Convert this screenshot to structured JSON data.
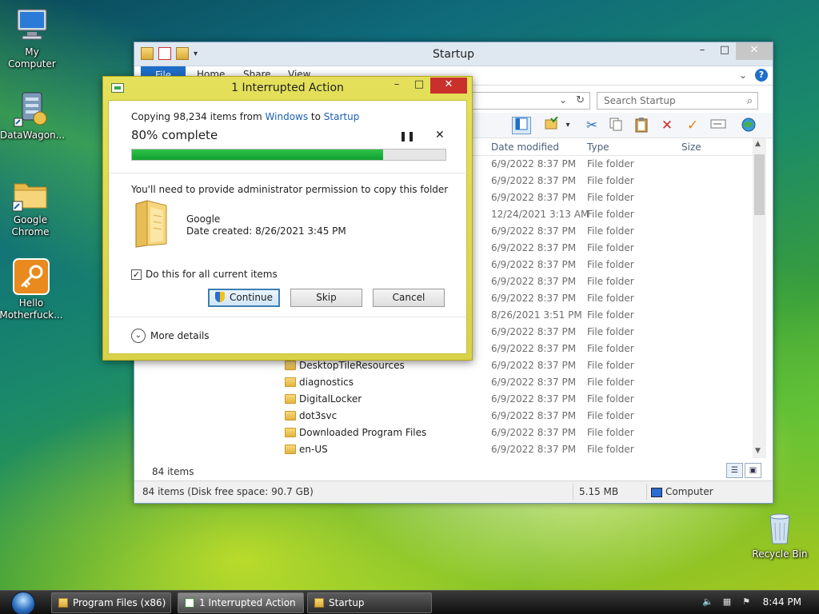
{
  "desktop": {
    "icons": [
      {
        "label": "My Computer"
      },
      {
        "label": "DataWagon..."
      },
      {
        "label": "Google Chrome"
      },
      {
        "label": "Hello Motherfuck..."
      },
      {
        "label": "Recycle Bin"
      }
    ]
  },
  "explorer": {
    "title": "Startup",
    "tabs": {
      "file": "File",
      "home": "Home",
      "share": "Share",
      "view": "View"
    },
    "search_placeholder": "Search Startup",
    "columns": {
      "date": "Date modified",
      "type": "Type",
      "size": "Size"
    },
    "rows": [
      {
        "name": "",
        "date": "6/9/2022 8:37 PM",
        "type": "File folder"
      },
      {
        "name": "",
        "date": "6/9/2022 8:37 PM",
        "type": "File folder"
      },
      {
        "name": "",
        "date": "6/9/2022 8:37 PM",
        "type": "File folder"
      },
      {
        "name": "",
        "date": "12/24/2021 3:13 AM",
        "type": "File folder"
      },
      {
        "name": "",
        "date": "6/9/2022 8:37 PM",
        "type": "File folder"
      },
      {
        "name": "",
        "date": "6/9/2022 8:37 PM",
        "type": "File folder"
      },
      {
        "name": "",
        "date": "6/9/2022 8:37 PM",
        "type": "File folder"
      },
      {
        "name": "",
        "date": "6/9/2022 8:37 PM",
        "type": "File folder"
      },
      {
        "name": "",
        "date": "6/9/2022 8:37 PM",
        "type": "File folder"
      },
      {
        "name": "",
        "date": "8/26/2021 3:51 PM",
        "type": "File folder"
      },
      {
        "name": "",
        "date": "6/9/2022 8:37 PM",
        "type": "File folder"
      },
      {
        "name": "",
        "date": "6/9/2022 8:37 PM",
        "type": "File folder"
      },
      {
        "name": "DesktopTileResources",
        "date": "6/9/2022 8:37 PM",
        "type": "File folder"
      },
      {
        "name": "diagnostics",
        "date": "6/9/2022 8:37 PM",
        "type": "File folder"
      },
      {
        "name": "DigitalLocker",
        "date": "6/9/2022 8:37 PM",
        "type": "File folder"
      },
      {
        "name": "dot3svc",
        "date": "6/9/2022 8:37 PM",
        "type": "File folder"
      },
      {
        "name": "Downloaded Program Files",
        "date": "6/9/2022 8:37 PM",
        "type": "File folder"
      },
      {
        "name": "en-US",
        "date": "6/9/2022 8:37 PM",
        "type": "File folder"
      }
    ],
    "items_count": "84 items",
    "status": {
      "left": "84 items (Disk free space: 90.7 GB)",
      "size": "5.15 MB",
      "location": "Computer"
    }
  },
  "dialog": {
    "title": "1 Interrupted Action",
    "copy_prefix": "Copying 98,234 items from ",
    "source": "Windows",
    "to_word": " to ",
    "dest": "Startup",
    "percent_text": "80% complete",
    "progress": 0.8,
    "permission_text": "You'll need to provide administrator permission to copy this folder",
    "folder_name": "Google",
    "folder_date": "Date created: 8/26/2021 3:45 PM",
    "checkbox_label": "Do this for all current items",
    "checkbox_checked": true,
    "continue_label": "Continue",
    "skip_label": "Skip",
    "cancel_label": "Cancel",
    "more_details": "More details"
  },
  "taskbar": {
    "tasks": [
      {
        "label": "Program Files (x86)"
      },
      {
        "label": "1 Interrupted Action"
      },
      {
        "label": "Startup"
      }
    ],
    "clock": "8:44 PM"
  }
}
